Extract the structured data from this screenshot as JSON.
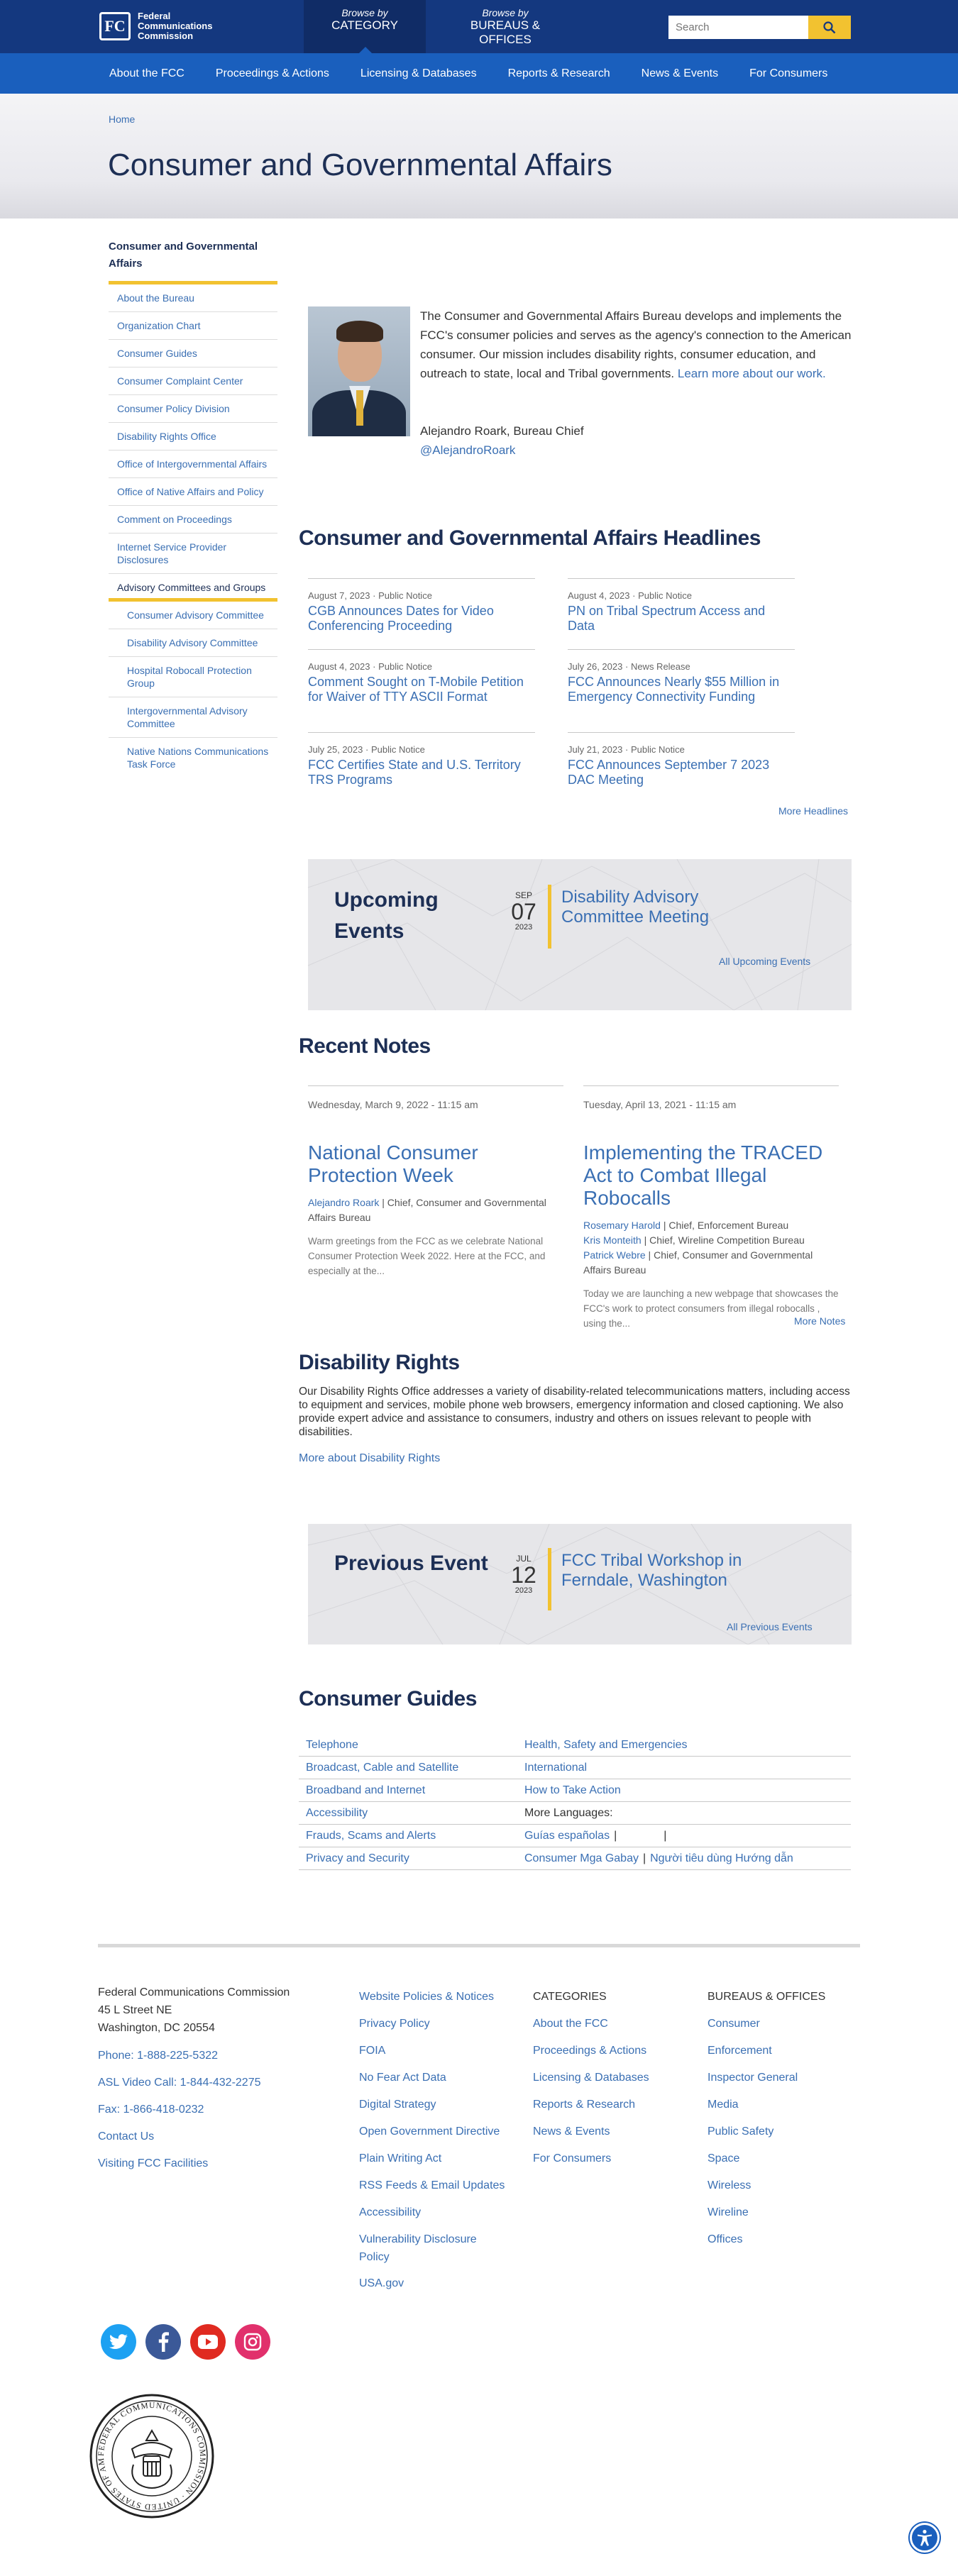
{
  "header": {
    "logo_lines": [
      "Federal",
      "Communications",
      "Commission"
    ],
    "logo_mark": "FC",
    "browse": [
      {
        "small": "Browse by",
        "big": "CATEGORY"
      },
      {
        "small": "Browse by",
        "big": "BUREAUS & OFFICES"
      }
    ],
    "search_placeholder": "Search",
    "search_icon": "search-icon"
  },
  "nav": [
    "About the FCC",
    "Proceedings & Actions",
    "Licensing & Databases",
    "Reports & Research",
    "News & Events",
    "For Consumers"
  ],
  "banner": {
    "breadcrumb": "Home",
    "title": "Consumer and Governmental Affairs"
  },
  "sidebar": {
    "title": "Consumer and Governmental Affairs",
    "items": [
      "About the Bureau",
      "Organization Chart",
      "Consumer Guides",
      "Consumer Complaint Center",
      "Consumer Policy Division",
      "Disability Rights Office",
      "Office of Intergovernmental Affairs",
      "Office of Native Affairs and Policy",
      "Comment on Proceedings",
      "Internet Service Provider Disclosures"
    ],
    "current": "Advisory Committees and Groups",
    "subitems": [
      "Consumer Advisory Committee",
      "Disability Advisory Committee",
      "Hospital Robocall Protection Group",
      "Intergovernmental Advisory Committee",
      "Native Nations Communications Task Force"
    ]
  },
  "intro": {
    "text": "The Consumer and Governmental Affairs Bureau develops and implements the FCC's consumer policies and serves as the agency's connection to the American consumer. Our mission includes disability rights, consumer education, and outreach to state, local and Tribal governments.",
    "link": "Learn more about our work.",
    "chief": "Alejandro Roark, Bureau Chief",
    "handle": "@AlejandroRoark"
  },
  "headlines": {
    "heading": "Consumer and Governmental Affairs Headlines",
    "items": [
      {
        "date": "August 7, 2023",
        "type": "Public Notice",
        "title": "CGB Announces Dates for Video Conferencing Proceeding"
      },
      {
        "date": "August 4, 2023",
        "type": "Public Notice",
        "title": "PN on Tribal Spectrum Access and Data"
      },
      {
        "date": "August 4, 2023",
        "type": "Public Notice",
        "title": "Comment Sought on T-Mobile Petition for Waiver of TTY ASCII Format"
      },
      {
        "date": "July 26, 2023",
        "type": "News Release",
        "title": "FCC Announces Nearly $55 Million in Emergency Connectivity Funding"
      },
      {
        "date": "July 25, 2023",
        "type": "Public Notice",
        "title": "FCC Certifies State and U.S. Territory TRS Programs"
      },
      {
        "date": "July 21, 2023",
        "type": "Public Notice",
        "title": "FCC Announces September 7 2023 DAC Meeting"
      }
    ],
    "more": "More Headlines",
    "dot": "·"
  },
  "upcoming": {
    "label_1": "Upcoming",
    "label_2": "Events",
    "month": "SEP",
    "day": "07",
    "year": "2023",
    "title": "Disability Advisory Committee Meeting",
    "all": "All Upcoming Events"
  },
  "notes": {
    "heading": "Recent Notes",
    "items": [
      {
        "date": "Wednesday, March 9, 2022 - 11:15 am",
        "title": "National Consumer Protection Week",
        "authors": [
          {
            "name": "Alejandro Roark",
            "role": " | Chief, Consumer and Governmental Affairs Bureau"
          }
        ],
        "excerpt": "Warm greetings from the FCC as we celebrate National Consumer Protection Week 2022.  Here at the FCC, and especially at the..."
      },
      {
        "date": "Tuesday, April 13, 2021 - 11:15 am",
        "title": "Implementing the TRACED Act to Combat Illegal Robocalls",
        "authors": [
          {
            "name": "Rosemary Harold",
            "role": " | Chief, Enforcement Bureau"
          },
          {
            "name": "Kris Monteith",
            "role": " | Chief, Wireline Competition Bureau"
          },
          {
            "name": "Patrick Webre",
            "role": " | Chief, Consumer and Governmental Affairs Bureau"
          }
        ],
        "excerpt": "Today we are launching a new webpage that showcases the FCC's work to protect consumers from illegal robocalls , using the..."
      }
    ],
    "more": "More Notes"
  },
  "disability": {
    "heading": "Disability Rights",
    "text": "Our Disability Rights Office addresses a variety of disability-related telecommunications matters, including access to equipment and services, mobile phone web browsers, emergency information and closed captioning. We also provide expert advice and assistance to consumers, industry and others on issues relevant to people with disabilities.",
    "link": "More about Disability Rights"
  },
  "previous": {
    "label": "Previous Event",
    "month": "JUL",
    "day": "12",
    "year": "2023",
    "title": "FCC Tribal Workshop in Ferndale, Washington",
    "all": "All Previous Events"
  },
  "guides": {
    "heading": "Consumer Guides",
    "rows": [
      [
        "Telephone",
        "Health, Safety and Emergencies"
      ],
      [
        "Broadcast, Cable and Satellite",
        "International"
      ],
      [
        "Broadband and Internet",
        "How to Take Action"
      ],
      [
        "Accessibility",
        "More Languages:"
      ],
      [
        "Frauds, Scams and Alerts",
        "Guías españolas"
      ],
      [
        "Privacy and Security",
        "Consumer Mga Gabay"
      ]
    ],
    "lang_extra": "Người tiêu dùng Hướng dẫn",
    "sep": "|"
  },
  "footer": {
    "address": [
      "Federal Communications Commission",
      "45 L Street NE",
      "Washington, DC 20554"
    ],
    "contact": [
      "Phone: 1-888-225-5322",
      "ASL Video Call: 1-844-432-2275",
      "Fax: 1-866-418-0232",
      "Contact Us",
      "Visiting FCC Facilities"
    ],
    "policies": [
      "Website Policies & Notices",
      "Privacy Policy",
      "FOIA",
      "No Fear Act Data",
      "Digital Strategy",
      "Open Government Directive",
      "Plain Writing Act",
      "RSS Feeds & Email Updates",
      "Accessibility",
      "Vulnerability Disclosure Policy",
      "USA.gov"
    ],
    "categories_head": "CATEGORIES",
    "categories": [
      "About the FCC",
      "Proceedings & Actions",
      "Licensing & Databases",
      "Reports & Research",
      "News & Events",
      "For Consumers"
    ],
    "bureaus_head": "BUREAUS & OFFICES",
    "bureaus": [
      "Consumer",
      "Enforcement",
      "Inspector General",
      "Media",
      "Public Safety",
      "Space",
      "Wireless",
      "Wireline",
      "Offices"
    ],
    "social": [
      {
        "icon": "twitter-icon",
        "color": "#1da1f2"
      },
      {
        "icon": "facebook-icon",
        "color": "#3b5998"
      },
      {
        "icon": "youtube-icon",
        "color": "#e02a20"
      },
      {
        "icon": "instagram-icon",
        "color": "#e1306c"
      }
    ],
    "seal_text": "FEDERAL COMMUNICATIONS COMMISSION · UNITED STATES OF AMERICA"
  },
  "colors": {
    "navy": "#14387f",
    "blue": "#1a5fbd",
    "link": "#3a6fb3",
    "accent": "#f2c230",
    "heading": "#1d2f55"
  }
}
